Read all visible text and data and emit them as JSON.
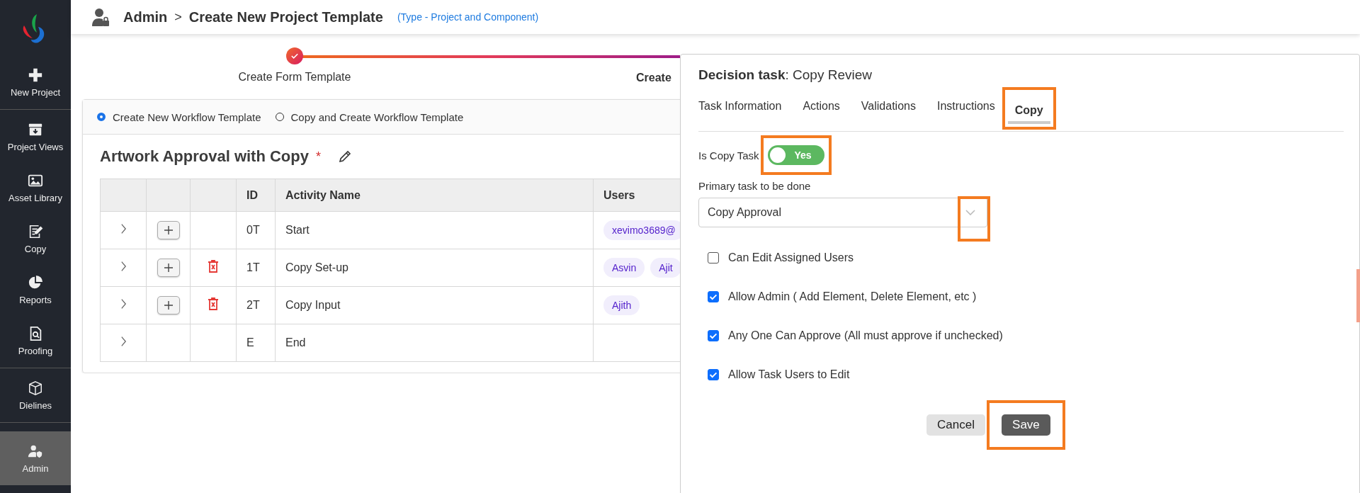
{
  "sidebar": {
    "groups": [
      [
        {
          "label": "New Project",
          "selected": false
        }
      ],
      [
        {
          "label": "Project Views",
          "selected": false
        },
        {
          "label": "Asset Library",
          "selected": false
        },
        {
          "label": "Copy",
          "selected": false
        },
        {
          "label": "Reports",
          "selected": false
        },
        {
          "label": "Proofing",
          "selected": false
        }
      ],
      [
        {
          "label": "Dielines",
          "selected": false
        }
      ],
      [
        {
          "label": "Admin",
          "selected": true
        }
      ]
    ]
  },
  "header": {
    "breadcrumb": [
      "Admin",
      "Create New Project Template"
    ],
    "separator": ">",
    "type_note": "(Type - Project and Component)"
  },
  "stepper": {
    "steps": [
      {
        "label": "Create Form Template",
        "done": true
      },
      {
        "label": "Create",
        "done": false
      }
    ]
  },
  "workflow_options": [
    {
      "label": "Create New Workflow Template",
      "selected": true
    },
    {
      "label": "Copy and Create Workflow Template",
      "selected": false
    }
  ],
  "template": {
    "name": "Artwork Approval with Copy",
    "required_mark": "*"
  },
  "table": {
    "columns": [
      "ID",
      "Activity Name",
      "Users"
    ],
    "rows": [
      {
        "has_add": true,
        "has_delete": false,
        "id": "0T",
        "name": "Start",
        "users": [
          "xevimo3689@"
        ]
      },
      {
        "has_add": true,
        "has_delete": true,
        "id": "1T",
        "name": "Copy Set-up",
        "users": [
          "Asvin",
          "Ajit"
        ]
      },
      {
        "has_add": true,
        "has_delete": true,
        "id": "2T",
        "name": "Copy Input",
        "users": [
          "Ajith"
        ]
      },
      {
        "has_add": false,
        "has_delete": false,
        "id": "E",
        "name": "End",
        "users": []
      }
    ]
  },
  "panel": {
    "title": "**Decision task**: Copy Review",
    "tabs": [
      {
        "label": "Task Information",
        "selected": false,
        "highlighted": false
      },
      {
        "label": "Actions",
        "selected": false,
        "highlighted": false
      },
      {
        "label": "Validations",
        "selected": false,
        "highlighted": false
      },
      {
        "label": "Instructions",
        "selected": false,
        "highlighted": false
      },
      {
        "label": "Copy",
        "selected": true,
        "highlighted": true
      }
    ],
    "copy_task": {
      "label": "Is Copy Task",
      "on": true,
      "state_text": "Yes",
      "highlighted": true
    },
    "primary_task": {
      "label": "Primary task to be done",
      "value": "Copy Approval",
      "chevron_highlighted": true
    },
    "options": [
      {
        "label": "Can Edit Assigned Users",
        "checked": false
      },
      {
        "label": "Allow Admin ( Add Element, Delete Element, etc )",
        "checked": true
      },
      {
        "label": "Any One Can Approve (All must approve if unchecked)",
        "checked": true
      },
      {
        "label": "Allow Task Users to Edit",
        "checked": true
      }
    ],
    "buttons": [
      {
        "label": "Cancel",
        "kind": "secondary",
        "highlighted": false
      },
      {
        "label": "Save",
        "kind": "primary",
        "highlighted": true
      }
    ]
  }
}
